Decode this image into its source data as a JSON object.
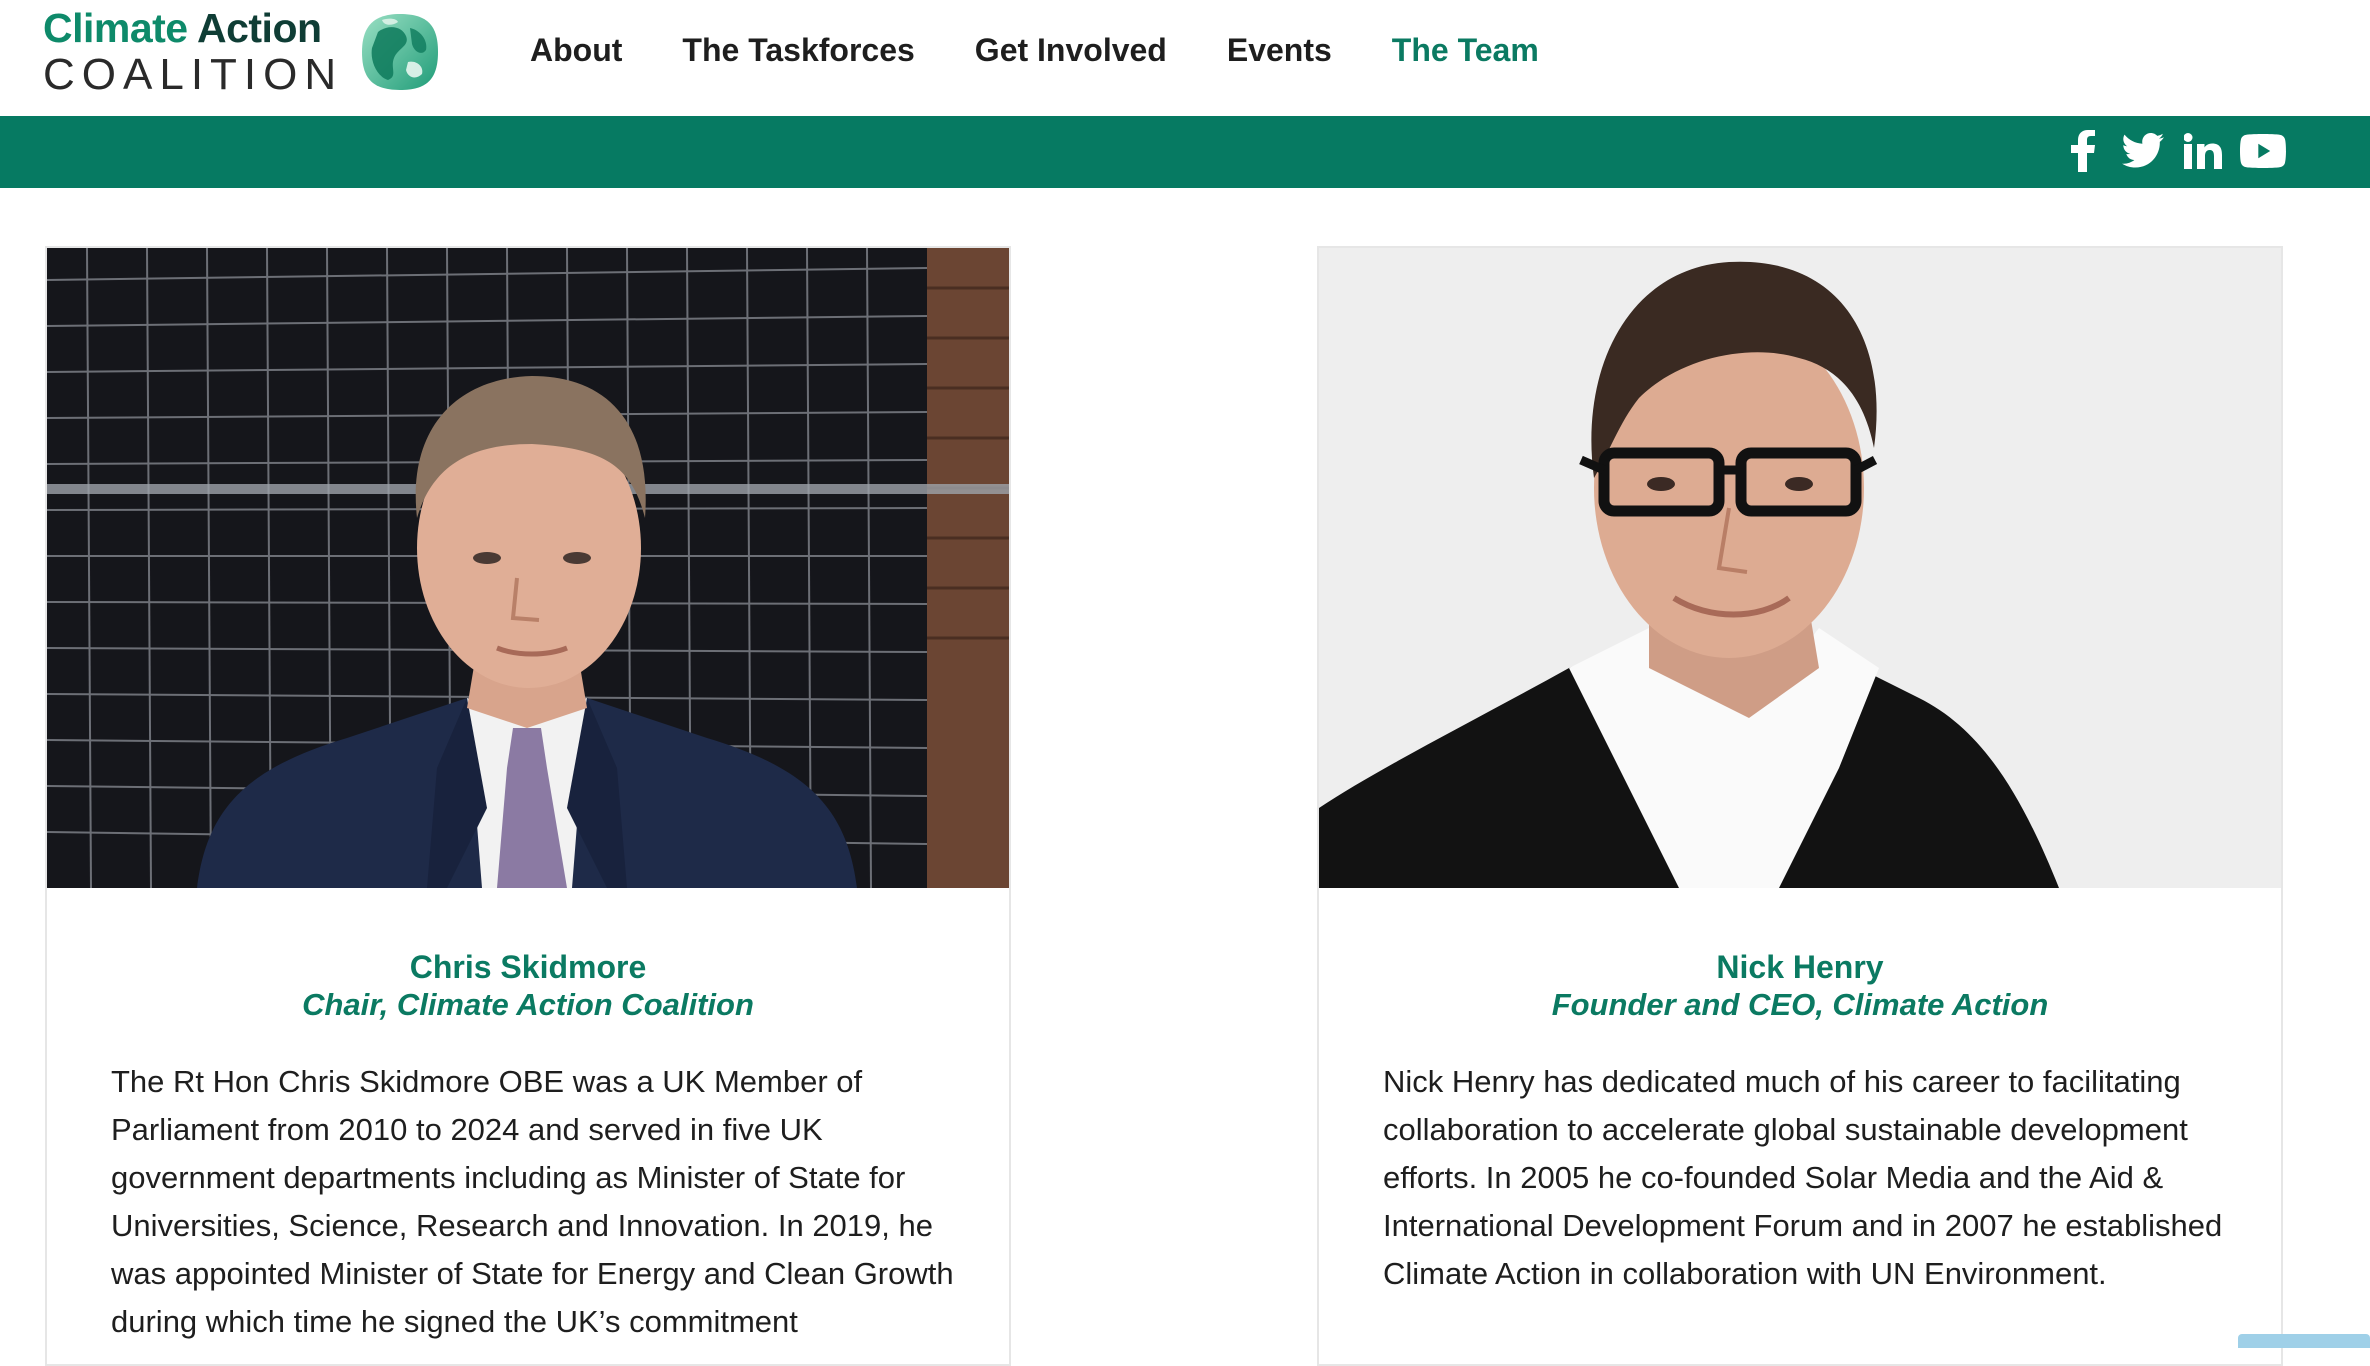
{
  "logo": {
    "word1": "Climate",
    "word2": "Action",
    "word3": "COALITION",
    "icon": "globe-logo-icon"
  },
  "nav": {
    "items": [
      {
        "label": "About"
      },
      {
        "label": "The Taskforces"
      },
      {
        "label": "Get Involved"
      },
      {
        "label": "Events"
      },
      {
        "label": "The Team",
        "active": true
      }
    ]
  },
  "social": {
    "icons": [
      "facebook-icon",
      "twitter-icon",
      "linkedin-icon",
      "youtube-icon"
    ]
  },
  "colors": {
    "brand_green": "#067a62",
    "accent_text": "#0b7a62"
  },
  "team": [
    {
      "name": "Chris Skidmore",
      "role": "Chair, Climate Action Coalition",
      "bio": "The Rt Hon Chris Skidmore OBE was a UK Member of Parliament from 2010 to 2024 and served in five UK government departments including as Minister of State for Universities, Science, Research and Innovation. In 2019, he was appointed Minister of State for Energy and Clean Growth during which time he signed the UK’s commitment"
    },
    {
      "name": "Nick Henry",
      "role": "Founder and CEO, Climate Action",
      "bio": "Nick Henry has dedicated much of his career to facilitating collaboration to accelerate global sustainable development efforts. In 2005 he co-founded Solar Media and the Aid & International Development Forum and in 2007 he established Climate Action in collaboration with UN Environment."
    }
  ]
}
